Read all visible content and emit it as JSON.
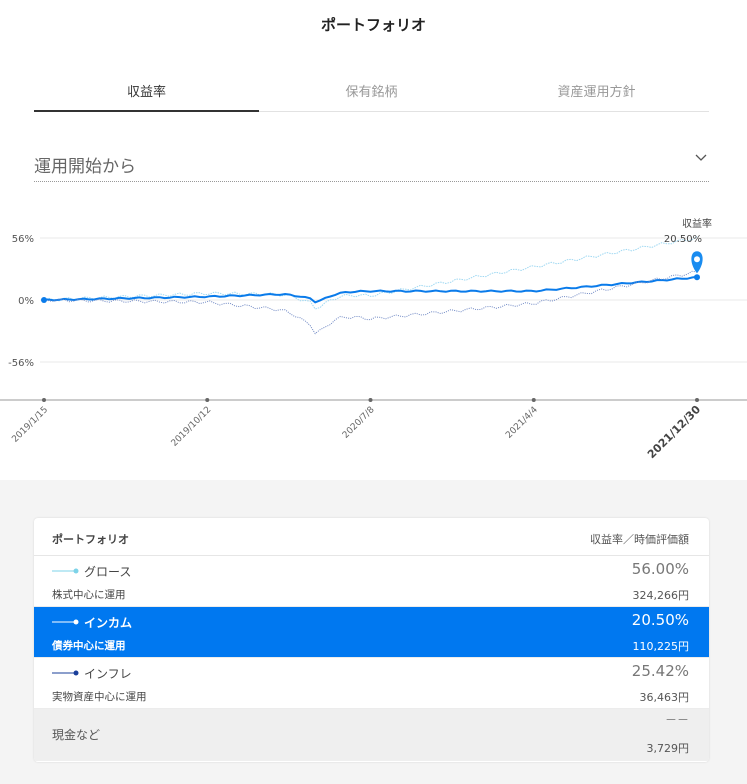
{
  "header": {
    "title": "ポートフォリオ"
  },
  "tabs": [
    {
      "label": "収益率",
      "active": true
    },
    {
      "label": "保有銘柄",
      "active": false
    },
    {
      "label": "資産運用方針",
      "active": false
    }
  ],
  "period_select": {
    "value": "運用開始から"
  },
  "chart": {
    "tooltip": {
      "label": "収益率",
      "value": "20.50%"
    },
    "y_ticks": [
      "56%",
      "0%",
      "-56%"
    ],
    "x_ticks": [
      "2019/1/15",
      "2019/10/12",
      "2020/7/8",
      "2021/4/4",
      "2021/12/30"
    ]
  },
  "chart_data": {
    "type": "line",
    "x": [
      "2019/1/15",
      "2019/10/12",
      "2020/7/8",
      "2021/4/4",
      "2021/12/30"
    ],
    "ylim": [
      -56,
      56
    ],
    "series": [
      {
        "name": "グロース",
        "color": "#9fd8f2",
        "values": [
          0,
          6,
          4,
          30,
          56
        ]
      },
      {
        "name": "インカム",
        "color": "#0a7bea",
        "values": [
          0,
          3,
          8,
          8,
          20.5
        ]
      },
      {
        "name": "インフレ",
        "color": "#6f88c4",
        "values": [
          0,
          -2,
          -17,
          -3,
          25.42
        ]
      }
    ]
  },
  "table": {
    "header_left": "ポートフォリオ",
    "header_right": "収益率／時価評価額",
    "rows": [
      {
        "name": "グロース",
        "desc": "株式中心に運用",
        "pct": "56.00%",
        "amount": "324,266円",
        "legend_color": "#7dd3e8",
        "active": false
      },
      {
        "name": "インカム",
        "desc": "債券中心に運用",
        "pct": "20.50%",
        "amount": "110,225円",
        "legend_color": "#ffffff",
        "active": true
      },
      {
        "name": "インフレ",
        "desc": "実物資産中心に運用",
        "pct": "25.42%",
        "amount": "36,463円",
        "legend_color": "#1a3f9a",
        "active": false
      }
    ],
    "cash": {
      "name": "現金など",
      "pct": "－－",
      "amount": "3,729円"
    }
  }
}
